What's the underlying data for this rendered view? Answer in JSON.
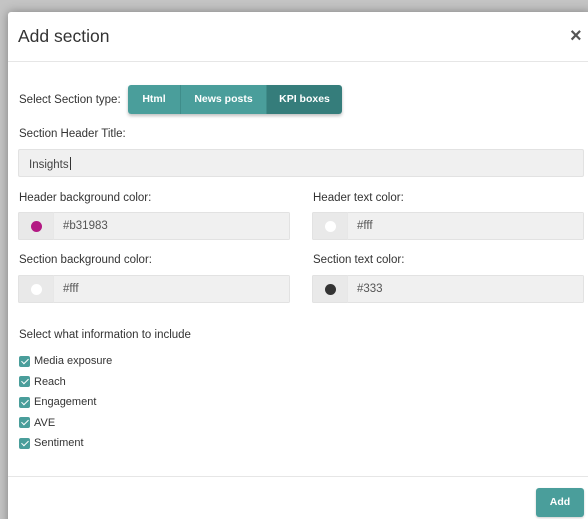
{
  "dialog": {
    "title": "Add section",
    "close_symbol": "×"
  },
  "section_type": {
    "label": "Select Section type:",
    "options": [
      "Html",
      "News posts",
      "KPI boxes"
    ],
    "selected": "KPI boxes"
  },
  "header_title": {
    "label": "Section Header Title:",
    "value": "Insights"
  },
  "colors": {
    "header_bg": {
      "label": "Header background color:",
      "value": "#b31983",
      "swatch": "#b31983"
    },
    "header_text": {
      "label": "Header text color:",
      "value": "#fff",
      "swatch": "#ffffff"
    },
    "section_bg": {
      "label": "Section background color:",
      "value": "#fff",
      "swatch": "#ffffff"
    },
    "section_text": {
      "label": "Section text color:",
      "value": "#333",
      "swatch": "#333333"
    }
  },
  "include": {
    "label": "Select what information to include",
    "items": [
      {
        "label": "Media exposure",
        "checked": true
      },
      {
        "label": "Reach",
        "checked": true
      },
      {
        "label": "Engagement",
        "checked": true
      },
      {
        "label": "AVE",
        "checked": true
      },
      {
        "label": "Sentiment",
        "checked": true
      }
    ]
  },
  "footer": {
    "add_label": "Add"
  },
  "accent_color": "#4a9e9b"
}
